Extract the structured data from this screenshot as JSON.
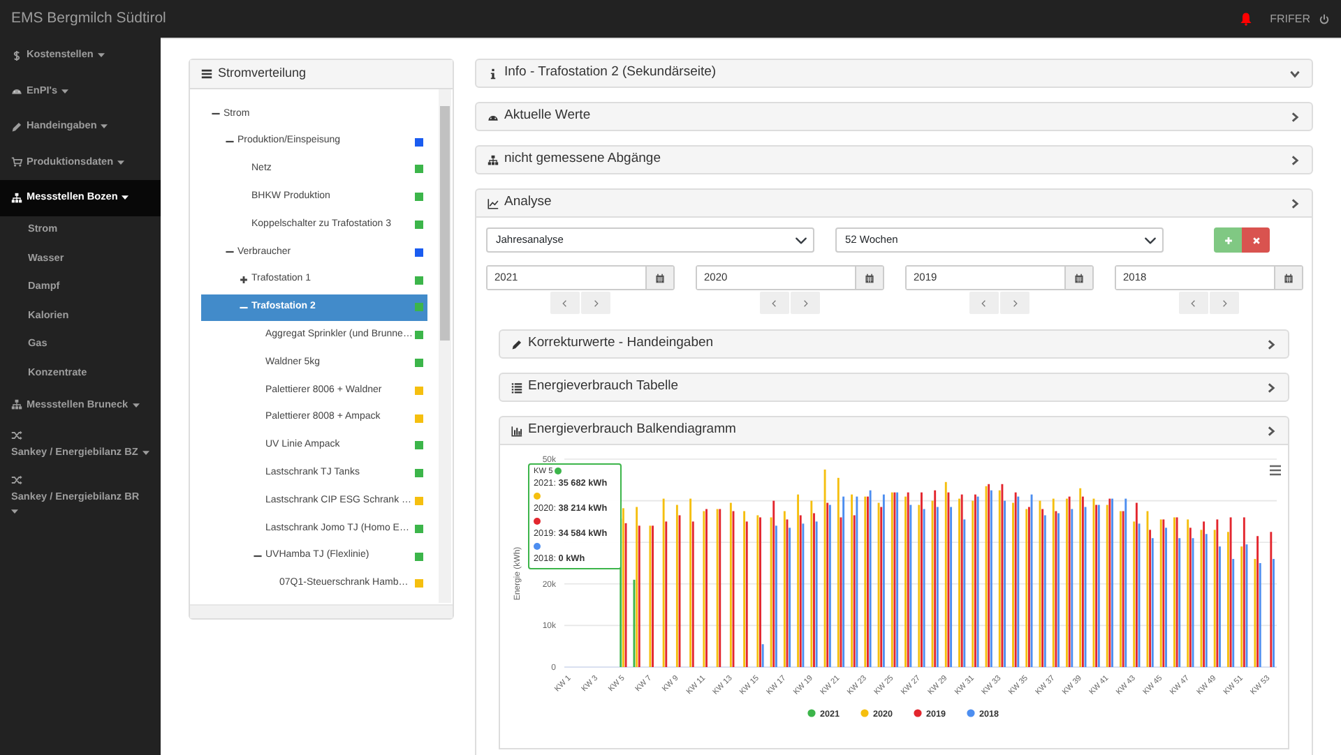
{
  "topbar": {
    "brand": "EMS Bergmilch Südtirol",
    "user": "FRIFER"
  },
  "sidebar": {
    "items": [
      {
        "label": "Kostenstellen",
        "selected": false
      },
      {
        "label": "EnPI's",
        "selected": false
      },
      {
        "label": "Handeingaben",
        "selected": false
      },
      {
        "label": "Produktionsdaten",
        "selected": false
      },
      {
        "label": "Messstellen Bozen",
        "selected": true,
        "children": [
          {
            "label": "Strom",
            "selected": false
          },
          {
            "label": "Wasser",
            "selected": false
          },
          {
            "label": "Dampf",
            "selected": false
          },
          {
            "label": "Kalorien",
            "selected": false
          },
          {
            "label": "Gas",
            "selected": false
          },
          {
            "label": "Konzentrate",
            "selected": false
          }
        ]
      },
      {
        "label": "Messstellen Bruneck",
        "selected": false
      },
      {
        "label": "Sankey / Energiebilanz BZ",
        "selected": false
      },
      {
        "label": "Sankey / Energiebilanz BR",
        "selected": false
      }
    ]
  },
  "tree": {
    "title": "Stromverteilung",
    "items": [
      {
        "label": "Strom",
        "expanded": true,
        "selected": false,
        "children": [
          {
            "label": "Produktion/Einspeisung",
            "expanded": true,
            "selected": false,
            "color": "#1a5cf0",
            "children": [
              {
                "label": "Netz",
                "selected": false,
                "color": "#3cb54a"
              },
              {
                "label": "BHKW Produktion",
                "selected": false,
                "color": "#3cb54a"
              },
              {
                "label": "Koppelschalter zu Trafostation 3",
                "selected": false,
                "color": "#3cb54a"
              }
            ]
          },
          {
            "label": "Verbraucher",
            "expanded": true,
            "selected": false,
            "color": "#1a5cf0",
            "children": [
              {
                "label": "Trafostation 1",
                "expanded": false,
                "selected": false,
                "color": "#3cb54a"
              },
              {
                "label": "Trafostation 2",
                "expanded": true,
                "selected": true,
                "color": "#3cb54a",
                "children": [
                  {
                    "label": "Aggregat Sprinkler (und Brunne…",
                    "selected": false,
                    "color": "#3cb54a"
                  },
                  {
                    "label": "Waldner 5kg",
                    "selected": false,
                    "color": "#3cb54a"
                  },
                  {
                    "label": "Palettierer 8006 + Waldner",
                    "selected": false,
                    "color": "#f5bf0f"
                  },
                  {
                    "label": "Palettierer 8008 + Ampack",
                    "selected": false,
                    "color": "#f5bf0f"
                  },
                  {
                    "label": "UV Linie Ampack",
                    "selected": false,
                    "color": "#3cb54a"
                  },
                  {
                    "label": "Lastschrank TJ Tanks",
                    "selected": false,
                    "color": "#3cb54a"
                  },
                  {
                    "label": "Lastschrank CIP ESG Schrank …",
                    "selected": false,
                    "color": "#f5bf0f"
                  },
                  {
                    "label": "Lastschrank Jomo TJ (Homo E…",
                    "selected": false,
                    "color": "#3cb54a"
                  },
                  {
                    "label": "UVHamba TJ (Flexlinie)",
                    "expanded": true,
                    "selected": false,
                    "color": "#3cb54a",
                    "children": [
                      {
                        "label": "07Q1-Steuerschrank Hamb…",
                        "selected": false,
                        "color": "#f5bf0f"
                      }
                    ]
                  }
                ]
              }
            ]
          }
        ]
      }
    ]
  },
  "panels": [
    {
      "title": "Info - Trafostation 2 (Sekundärseite)",
      "expanded": true
    },
    {
      "title": "Aktuelle Werte",
      "expanded": false
    },
    {
      "title": "nicht gemessene Abgänge",
      "expanded": false
    },
    {
      "title": "Analyse",
      "expanded": false
    }
  ],
  "analysis": {
    "selects": [
      {
        "value": "Jahresanalyse"
      },
      {
        "value": "52 Wochen"
      }
    ],
    "years": [
      {
        "value": "2021"
      },
      {
        "value": "2020"
      },
      {
        "value": "2019"
      },
      {
        "value": "2018"
      }
    ],
    "subpanels": [
      {
        "title": "Korrekturwerte - Handeingaben",
        "expanded": false
      },
      {
        "title": "Energieverbrauch Tabelle",
        "expanded": false
      },
      {
        "title": "Energieverbrauch Balkendiagramm",
        "expanded": false
      }
    ],
    "chart_data": {
      "type": "bar",
      "ylabel": "Energie (kWh)",
      "ylim": [
        0,
        50000
      ],
      "grid": true,
      "legend": "bottom",
      "yticks": [
        {
          "value": 0,
          "label": "0"
        },
        {
          "value": 10000,
          "label": "10k"
        },
        {
          "value": 20000,
          "label": "20k"
        },
        {
          "value": 50000,
          "label": "50k"
        }
      ],
      "categories": [
        "KW 1",
        null,
        "KW 3",
        null,
        "KW 5",
        null,
        "KW 7",
        null,
        "KW 9",
        null,
        "KW 11",
        null,
        "KW 13",
        null,
        "KW 15",
        null,
        "KW 17",
        null,
        "KW 19",
        null,
        "KW 21",
        null,
        "KW 23",
        null,
        "KW 25",
        null,
        "KW 27",
        null,
        "KW 29",
        null,
        "KW 31",
        null,
        "KW 33",
        null,
        "KW 35",
        null,
        "KW 37",
        null,
        "KW 39",
        null,
        "KW 41",
        null,
        "KW 43",
        null,
        "KW 45",
        null,
        "KW 47",
        null,
        "KW 49",
        null,
        "KW 51",
        null,
        "KW 53"
      ],
      "series": [
        {
          "name": "2021",
          "color": "#3cb54a",
          "values": [
            null,
            null,
            null,
            null,
            35700,
            21000,
            null,
            null,
            null,
            null,
            null,
            null,
            null,
            null,
            null,
            null,
            null,
            null,
            null,
            null,
            null,
            null,
            null,
            null,
            null,
            null,
            null,
            null,
            null,
            null,
            null,
            null,
            null,
            null,
            null,
            null,
            null,
            null,
            null,
            null,
            null,
            null,
            null,
            null,
            null,
            null,
            null,
            null,
            null,
            null,
            null,
            null,
            null
          ]
        },
        {
          "name": "2020",
          "color": "#f5bf0f",
          "values": [
            null,
            null,
            null,
            null,
            38200,
            38500,
            34000,
            40500,
            39000,
            40500,
            37500,
            38000,
            39500,
            37500,
            36500,
            36000,
            37500,
            41500,
            40000,
            47500,
            45500,
            41500,
            41000,
            39500,
            42000,
            41000,
            39000,
            40000,
            44500,
            40500,
            40000,
            43500,
            42500,
            39500,
            38000,
            40000,
            40500,
            40500,
            43000,
            40500,
            39000,
            37500,
            35000,
            37500,
            35500,
            36000,
            35500,
            33000,
            33000,
            32500,
            29000,
            26000,
            null
          ]
        },
        {
          "name": "2019",
          "color": "#e3262e",
          "values": [
            null,
            null,
            null,
            null,
            34600,
            34000,
            34000,
            35000,
            36500,
            35000,
            38000,
            38000,
            37500,
            35000,
            36000,
            40000,
            35500,
            36500,
            37000,
            39500,
            36000,
            36500,
            41000,
            38500,
            42000,
            42000,
            42000,
            42500,
            42000,
            41500,
            41500,
            44000,
            44000,
            42000,
            38500,
            38000,
            37500,
            41000,
            41000,
            39000,
            40500,
            37500,
            39500,
            33000,
            35500,
            36000,
            33500,
            35000,
            35500,
            36000,
            36000,
            31500,
            32500
          ]
        },
        {
          "name": "2018",
          "color": "#4d8ef0",
          "values": [
            0,
            0,
            0,
            0,
            0,
            0,
            0,
            0,
            0,
            0,
            0,
            0,
            0,
            0,
            5500,
            34000,
            33500,
            34500,
            35000,
            39000,
            41000,
            41000,
            42500,
            41500,
            42000,
            39000,
            38000,
            38500,
            38500,
            35500,
            41000,
            42500,
            40000,
            41000,
            41500,
            36500,
            37000,
            38000,
            38500,
            39000,
            40500,
            40500,
            34500,
            31000,
            33500,
            31000,
            31000,
            32000,
            29000,
            26000,
            29500,
            25000,
            26000
          ]
        }
      ]
    },
    "tooltip": {
      "title": "KW 5",
      "rows": [
        {
          "text": "2021: **35 682 kWh**",
          "color": "#3cb54a"
        },
        {
          "text": "2020: **38 214 kWh**",
          "color": "#f5bf0f"
        },
        {
          "text": "2019: **34 584 kWh**",
          "color": "#e3262e"
        },
        {
          "text": "2018: **0 kWh**",
          "color": "#4d8ef0"
        }
      ]
    }
  }
}
